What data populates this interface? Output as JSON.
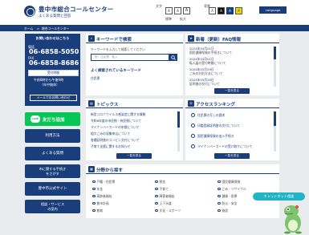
{
  "header": {
    "title": "豊中市総合コールセンター",
    "subtitle": "よくある質問と回答",
    "font_size_label": "文字",
    "color_label": "背景",
    "size_small": "標準",
    "size_large": "拡大",
    "lang_label": "Language"
  },
  "breadcrumb": {
    "home": "ホーム",
    "sep": ">",
    "current": "総合コールセンター"
  },
  "contact": {
    "heading": "お問い合わせはこちら",
    "tel_label": "電話",
    "tel": "06-6858-5050",
    "fax_label": "FAX",
    "fax": "06-6858-8686",
    "hours_label": "受付時間",
    "hours_line1": "午前8時から午後9時",
    "hours_line2": "（年中無休）",
    "email_label": "メールでのお問い合わせ"
  },
  "side_buttons": {
    "line_icon": "LINE",
    "line": "友だち追加",
    "b1": "利用方法",
    "b2": "よくある質問",
    "b3a": "市に関する手続き",
    "b3b": "をさがす",
    "b4": "豊中市公式サイト",
    "b5a": "相談・サービス",
    "b5b": "の案内"
  },
  "keyword": {
    "title": "キーワードで検索",
    "hint": "キーワードを入力して検索してください",
    "placeholder": "例：住民票　転入",
    "popular_title": "よく検索されているキーワード",
    "popular_tag": "住民票"
  },
  "latest": {
    "title": "新着（更新）FAQ情報",
    "items": [
      {
        "date": "2024年04月01日",
        "text": "国民健康保険の手続きについて"
      },
      {
        "date": "2024年04月01日",
        "text": "転入届の受付時間について"
      },
      {
        "date": "2024年03月29日",
        "text": "ごみの分別方法について"
      },
      {
        "date": "2024年03月28日",
        "text": "証明書の交付について"
      }
    ],
    "more": "一覧を見る"
  },
  "topics": {
    "title": "トピックス",
    "items": [
      "新型コロナウイルス感染症に関する情報",
      "令和6年度の市民税・府民税について",
      "マイナンバーカードの申請について",
      "粗大ごみの収集申込について",
      "各種証明書のコンビニ交付について",
      "子育て支援に関するお知らせ"
    ],
    "more": "一覧を見る"
  },
  "ranking": {
    "title": "アクセスランキング",
    "items": [
      "住民票の写しの請求",
      "印鑑登録証明書の交付について",
      "国民健康保険の加入手続き",
      "マイナンバーカードの受け取りについて"
    ],
    "more": "一覧を見る"
  },
  "categories": {
    "title": "分野から探す",
    "items": [
      "戸籍・住民票",
      "税金",
      "国民健康保険",
      "年金",
      "子育て",
      "ごみ・リサイクル",
      "高齢者福祉",
      "障害者福祉",
      "健康・医療",
      "都市計画",
      "上下水道",
      "防災・安全",
      "教育",
      "文化・スポーツ",
      "施設"
    ]
  },
  "chat": {
    "label": "チャットボット相談"
  },
  "colors": {
    "primary": "#1a3d7c",
    "line_green": "#06c755",
    "chat_teal": "#22b4c4",
    "background": "#e9ecef"
  }
}
